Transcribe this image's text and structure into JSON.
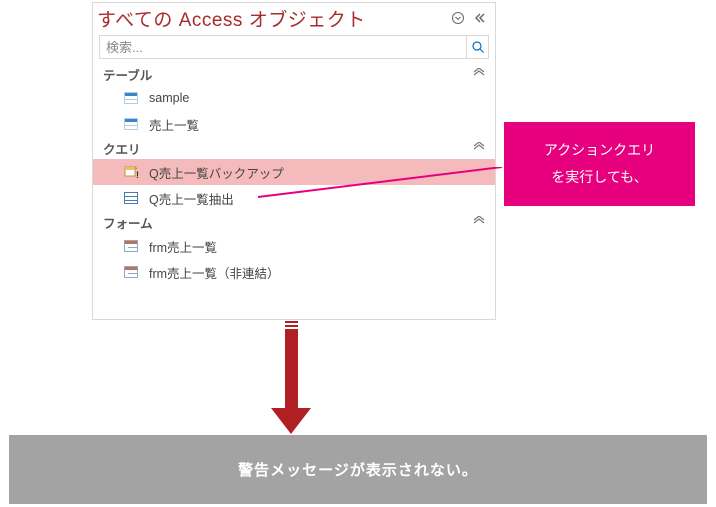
{
  "pane": {
    "title": "すべての Access オブジェクト",
    "search_placeholder": "検索...",
    "groups": [
      {
        "key": "tables",
        "label": "テーブル"
      },
      {
        "key": "queries",
        "label": "クエリ"
      },
      {
        "key": "forms",
        "label": "フォーム"
      }
    ],
    "items": {
      "tables": [
        {
          "name": "sample",
          "icon": "table-icon"
        },
        {
          "name": "売上一覧",
          "icon": "table-icon"
        }
      ],
      "queries": [
        {
          "name": "Q売上一覧バックアップ",
          "icon": "make-table-query-icon",
          "selected": true
        },
        {
          "name": "Q売上一覧抽出",
          "icon": "select-query-icon"
        }
      ],
      "forms": [
        {
          "name": "frm売上一覧",
          "icon": "form-icon"
        },
        {
          "name": "frm売上一覧（非連結）",
          "icon": "form-icon"
        }
      ]
    }
  },
  "callout_line1": "アクションクエリ",
  "callout_line2": "を実行しても、",
  "result_text": "警告メッセージが表示されない。",
  "colors": {
    "accent": "#a92b2b",
    "callout_bg": "#e6007e",
    "arrow": "#b01f24"
  }
}
